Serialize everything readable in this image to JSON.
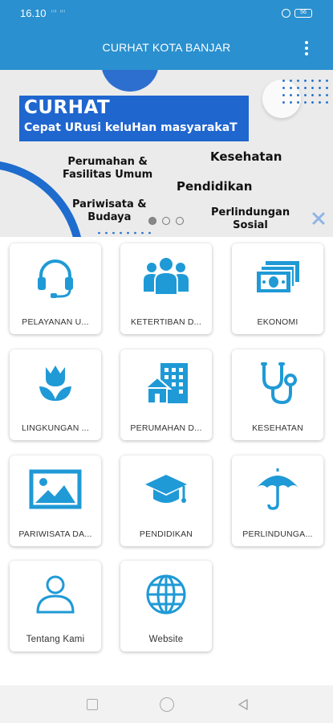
{
  "status_bar": {
    "time": "16.10",
    "signal_text": "ⁱˡˡ ⁱˡˡ",
    "battery": "56"
  },
  "app_bar": {
    "title": "CURHAT KOTA BANJAR",
    "menu_icon": "more-vert-icon"
  },
  "banner": {
    "title": "CURHAT",
    "subtitle": "Cepat URusi keluHan masyarakaT",
    "labels": [
      "Perumahan &\nFasilitas Umum",
      "Kesehatan",
      "Pendidikan",
      "Pariwisata &\nBudaya",
      "Perlindungan\nSosial"
    ]
  },
  "menu": {
    "items": [
      {
        "label": "PELAYANAN U...",
        "icon": "headset-icon"
      },
      {
        "label": "KETERTIBAN D...",
        "icon": "group-icon"
      },
      {
        "label": "EKONOMI",
        "icon": "money-icon"
      },
      {
        "label": "LINGKUNGAN ...",
        "icon": "flower-icon"
      },
      {
        "label": "PERUMAHAN D...",
        "icon": "home-building-icon"
      },
      {
        "label": "KESEHATAN",
        "icon": "stethoscope-icon"
      },
      {
        "label": "PARIWISATA DA...",
        "icon": "landscape-icon"
      },
      {
        "label": "PENDIDIKAN",
        "icon": "graduation-cap-icon"
      },
      {
        "label": "PERLINDUNGA...",
        "icon": "umbrella-icon"
      },
      {
        "label": "Tentang Kami",
        "icon": "person-icon"
      },
      {
        "label": "Website",
        "icon": "globe-icon"
      }
    ]
  },
  "colors": {
    "primary": "#2a90cf",
    "banner_blue": "#1f66cf",
    "icon_blue": "#1f9ad6"
  }
}
